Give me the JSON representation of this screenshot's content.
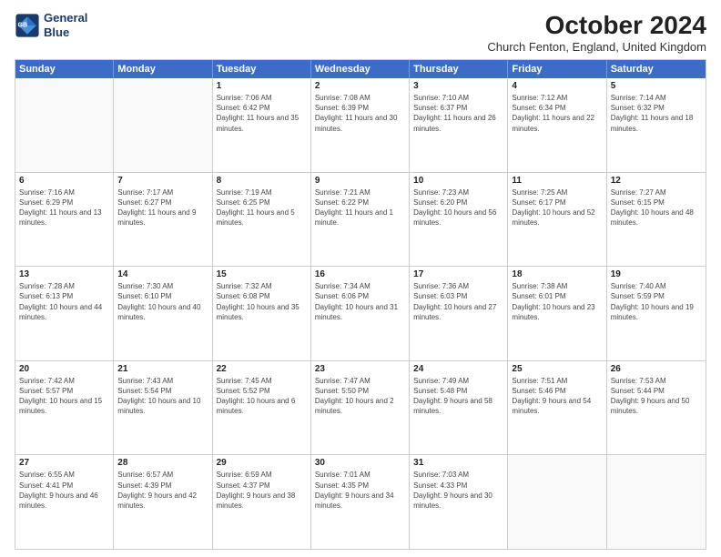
{
  "header": {
    "logo_line1": "General",
    "logo_line2": "Blue",
    "month_title": "October 2024",
    "location": "Church Fenton, England, United Kingdom"
  },
  "weekdays": [
    "Sunday",
    "Monday",
    "Tuesday",
    "Wednesday",
    "Thursday",
    "Friday",
    "Saturday"
  ],
  "rows": [
    [
      {
        "date": "",
        "info": ""
      },
      {
        "date": "",
        "info": ""
      },
      {
        "date": "1",
        "info": "Sunrise: 7:06 AM\nSunset: 6:42 PM\nDaylight: 11 hours and 35 minutes."
      },
      {
        "date": "2",
        "info": "Sunrise: 7:08 AM\nSunset: 6:39 PM\nDaylight: 11 hours and 30 minutes."
      },
      {
        "date": "3",
        "info": "Sunrise: 7:10 AM\nSunset: 6:37 PM\nDaylight: 11 hours and 26 minutes."
      },
      {
        "date": "4",
        "info": "Sunrise: 7:12 AM\nSunset: 6:34 PM\nDaylight: 11 hours and 22 minutes."
      },
      {
        "date": "5",
        "info": "Sunrise: 7:14 AM\nSunset: 6:32 PM\nDaylight: 11 hours and 18 minutes."
      }
    ],
    [
      {
        "date": "6",
        "info": "Sunrise: 7:16 AM\nSunset: 6:29 PM\nDaylight: 11 hours and 13 minutes."
      },
      {
        "date": "7",
        "info": "Sunrise: 7:17 AM\nSunset: 6:27 PM\nDaylight: 11 hours and 9 minutes."
      },
      {
        "date": "8",
        "info": "Sunrise: 7:19 AM\nSunset: 6:25 PM\nDaylight: 11 hours and 5 minutes."
      },
      {
        "date": "9",
        "info": "Sunrise: 7:21 AM\nSunset: 6:22 PM\nDaylight: 11 hours and 1 minute."
      },
      {
        "date": "10",
        "info": "Sunrise: 7:23 AM\nSunset: 6:20 PM\nDaylight: 10 hours and 56 minutes."
      },
      {
        "date": "11",
        "info": "Sunrise: 7:25 AM\nSunset: 6:17 PM\nDaylight: 10 hours and 52 minutes."
      },
      {
        "date": "12",
        "info": "Sunrise: 7:27 AM\nSunset: 6:15 PM\nDaylight: 10 hours and 48 minutes."
      }
    ],
    [
      {
        "date": "13",
        "info": "Sunrise: 7:28 AM\nSunset: 6:13 PM\nDaylight: 10 hours and 44 minutes."
      },
      {
        "date": "14",
        "info": "Sunrise: 7:30 AM\nSunset: 6:10 PM\nDaylight: 10 hours and 40 minutes."
      },
      {
        "date": "15",
        "info": "Sunrise: 7:32 AM\nSunset: 6:08 PM\nDaylight: 10 hours and 35 minutes."
      },
      {
        "date": "16",
        "info": "Sunrise: 7:34 AM\nSunset: 6:06 PM\nDaylight: 10 hours and 31 minutes."
      },
      {
        "date": "17",
        "info": "Sunrise: 7:36 AM\nSunset: 6:03 PM\nDaylight: 10 hours and 27 minutes."
      },
      {
        "date": "18",
        "info": "Sunrise: 7:38 AM\nSunset: 6:01 PM\nDaylight: 10 hours and 23 minutes."
      },
      {
        "date": "19",
        "info": "Sunrise: 7:40 AM\nSunset: 5:59 PM\nDaylight: 10 hours and 19 minutes."
      }
    ],
    [
      {
        "date": "20",
        "info": "Sunrise: 7:42 AM\nSunset: 5:57 PM\nDaylight: 10 hours and 15 minutes."
      },
      {
        "date": "21",
        "info": "Sunrise: 7:43 AM\nSunset: 5:54 PM\nDaylight: 10 hours and 10 minutes."
      },
      {
        "date": "22",
        "info": "Sunrise: 7:45 AM\nSunset: 5:52 PM\nDaylight: 10 hours and 6 minutes."
      },
      {
        "date": "23",
        "info": "Sunrise: 7:47 AM\nSunset: 5:50 PM\nDaylight: 10 hours and 2 minutes."
      },
      {
        "date": "24",
        "info": "Sunrise: 7:49 AM\nSunset: 5:48 PM\nDaylight: 9 hours and 58 minutes."
      },
      {
        "date": "25",
        "info": "Sunrise: 7:51 AM\nSunset: 5:46 PM\nDaylight: 9 hours and 54 minutes."
      },
      {
        "date": "26",
        "info": "Sunrise: 7:53 AM\nSunset: 5:44 PM\nDaylight: 9 hours and 50 minutes."
      }
    ],
    [
      {
        "date": "27",
        "info": "Sunrise: 6:55 AM\nSunset: 4:41 PM\nDaylight: 9 hours and 46 minutes."
      },
      {
        "date": "28",
        "info": "Sunrise: 6:57 AM\nSunset: 4:39 PM\nDaylight: 9 hours and 42 minutes."
      },
      {
        "date": "29",
        "info": "Sunrise: 6:59 AM\nSunset: 4:37 PM\nDaylight: 9 hours and 38 minutes."
      },
      {
        "date": "30",
        "info": "Sunrise: 7:01 AM\nSunset: 4:35 PM\nDaylight: 9 hours and 34 minutes."
      },
      {
        "date": "31",
        "info": "Sunrise: 7:03 AM\nSunset: 4:33 PM\nDaylight: 9 hours and 30 minutes."
      },
      {
        "date": "",
        "info": ""
      },
      {
        "date": "",
        "info": ""
      }
    ]
  ]
}
